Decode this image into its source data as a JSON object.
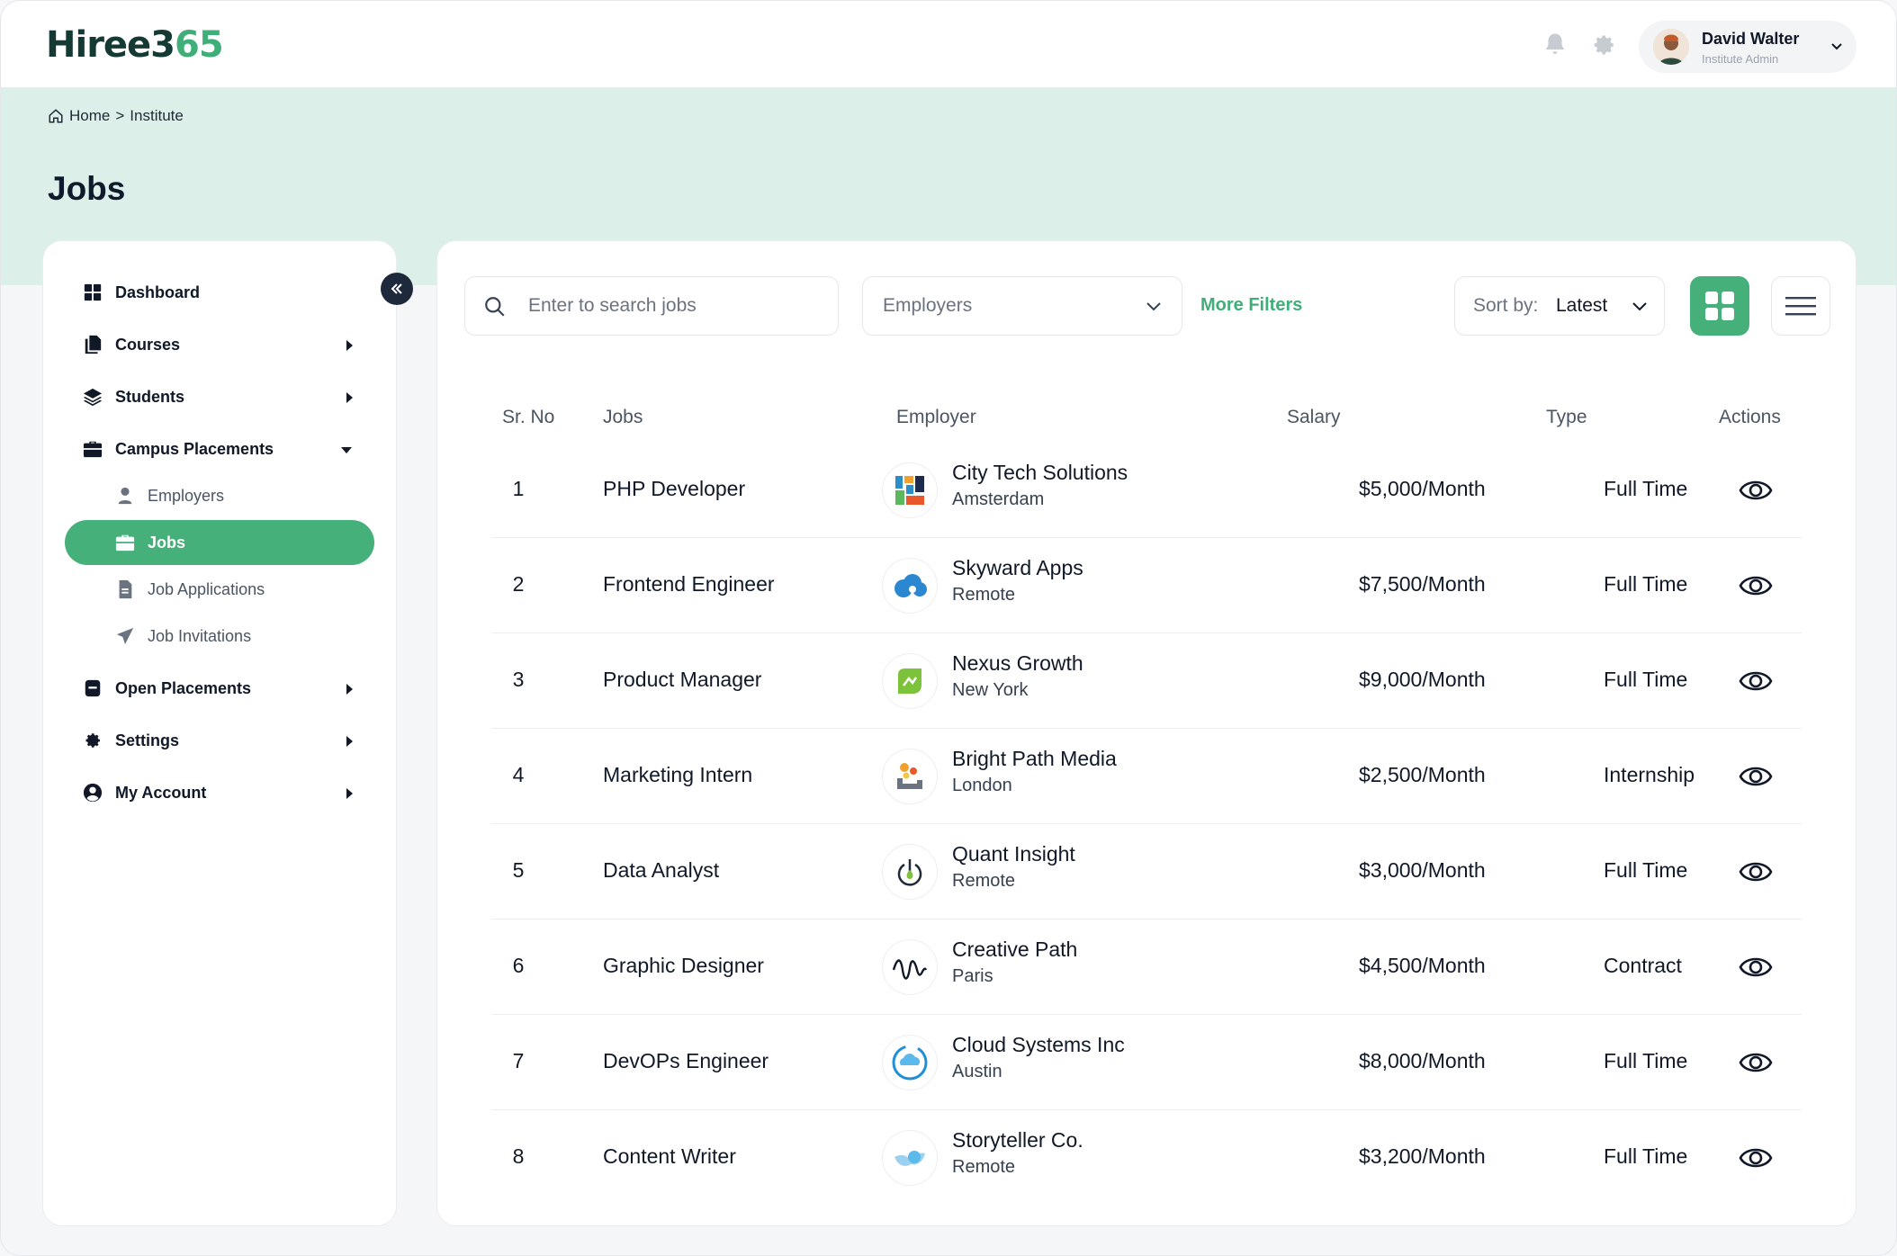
{
  "app": {
    "logo_main": "Hiree3",
    "logo_accent": "65"
  },
  "header": {
    "user_name": "David Walter",
    "user_role": "Institute Admin"
  },
  "breadcrumb": {
    "home": "Home",
    "separator": ">",
    "current": "Institute"
  },
  "page_title": "Jobs",
  "sidebar": {
    "items": [
      {
        "label": "Dashboard"
      },
      {
        "label": "Courses"
      },
      {
        "label": "Students"
      },
      {
        "label": "Campus Placements"
      },
      {
        "label": "Employers"
      },
      {
        "label": "Jobs"
      },
      {
        "label": "Job Applications"
      },
      {
        "label": "Job Invitations"
      },
      {
        "label": "Open Placements"
      },
      {
        "label": "Settings"
      },
      {
        "label": "My Account"
      }
    ]
  },
  "toolbar": {
    "search_placeholder": "Enter to search jobs",
    "employers_select": "Employers",
    "more_filters": "More Filters",
    "sort_label": "Sort by:",
    "sort_value": "Latest"
  },
  "table": {
    "headers": [
      "Sr. No",
      "Jobs",
      "Employer",
      "Salary",
      "Type",
      "Actions"
    ],
    "rows": [
      {
        "sr": "1",
        "job": "PHP Developer",
        "employer": "City Tech Solutions",
        "location": "Amsterdam",
        "salary": "$5,000/Month",
        "type": "Full Time"
      },
      {
        "sr": "2",
        "job": "Frontend Engineer",
        "employer": "Skyward Apps",
        "location": "Remote",
        "salary": "$7,500/Month",
        "type": "Full Time"
      },
      {
        "sr": "3",
        "job": "Product Manager",
        "employer": "Nexus Growth",
        "location": "New York",
        "salary": "$9,000/Month",
        "type": "Full Time"
      },
      {
        "sr": "4",
        "job": "Marketing Intern",
        "employer": "Bright Path Media",
        "location": "London",
        "salary": "$2,500/Month",
        "type": "Internship"
      },
      {
        "sr": "5",
        "job": "Data Analyst",
        "employer": "Quant Insight",
        "location": "Remote",
        "salary": "$3,000/Month",
        "type": "Full Time"
      },
      {
        "sr": "6",
        "job": "Graphic Designer",
        "employer": "Creative Path",
        "location": "Paris",
        "salary": "$4,500/Month",
        "type": "Contract"
      },
      {
        "sr": "7",
        "job": "DevOPs Engineer",
        "employer": "Cloud Systems Inc",
        "location": "Austin",
        "salary": "$8,000/Month",
        "type": "Full Time"
      },
      {
        "sr": "8",
        "job": "Content Writer",
        "employer": "Storyteller Co.",
        "location": "Remote",
        "salary": "$3,200/Month",
        "type": "Full Time"
      }
    ]
  },
  "colors": {
    "accent": "#46b07b",
    "band": "#dcefe8",
    "dark": "#1e293b"
  }
}
